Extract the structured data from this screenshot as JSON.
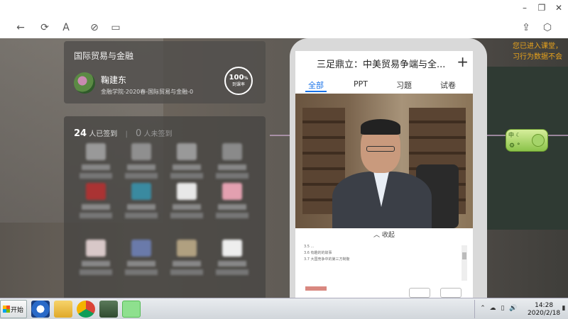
{
  "window": {
    "minimize": "–",
    "restore": "❐",
    "close": "✕"
  },
  "toolbar": {
    "back": "←",
    "refresh": "⟳",
    "font": "A",
    "link": "⊘",
    "layout": "▭",
    "share": "⇪",
    "box": "⬡"
  },
  "course": {
    "title": "国际贸易与金融",
    "teacher": "鞠建东",
    "subtitle": "金融学院-2020春-国际贸易与金融-0",
    "rate_value": "100",
    "rate_unit": "%",
    "rate_label": "到课率"
  },
  "signin": {
    "signed_count": "24",
    "signed_label": "人已签到",
    "unsigned_count": "0",
    "unsigned_label": "人未签到"
  },
  "phone": {
    "title": "三足鼎立：中美贸易争端与全...",
    "plus": "+",
    "tabs": [
      "全部",
      "PPT",
      "习题",
      "试卷"
    ],
    "collapse": "收起",
    "outline": [
      "3.5 ...",
      "3.6 有趣的的故事",
      "3.7 大国竞争中的第三方制衡"
    ]
  },
  "notice": {
    "line1": "您已进入课堂，",
    "line2": "习行为数据不会"
  },
  "widget": {
    "label": "中",
    "moon": "☾",
    "gear": "⚙",
    "sub": "°"
  },
  "taskbar": {
    "start": "开始",
    "time": "14:28",
    "date": "2020/2/18",
    "tray": [
      "⌃",
      "☁",
      "▯",
      "🔊",
      "▮"
    ]
  },
  "colors": {
    "accent": "#1a73e8",
    "notice": "#e7a21c",
    "widget": "#8bc34a"
  }
}
